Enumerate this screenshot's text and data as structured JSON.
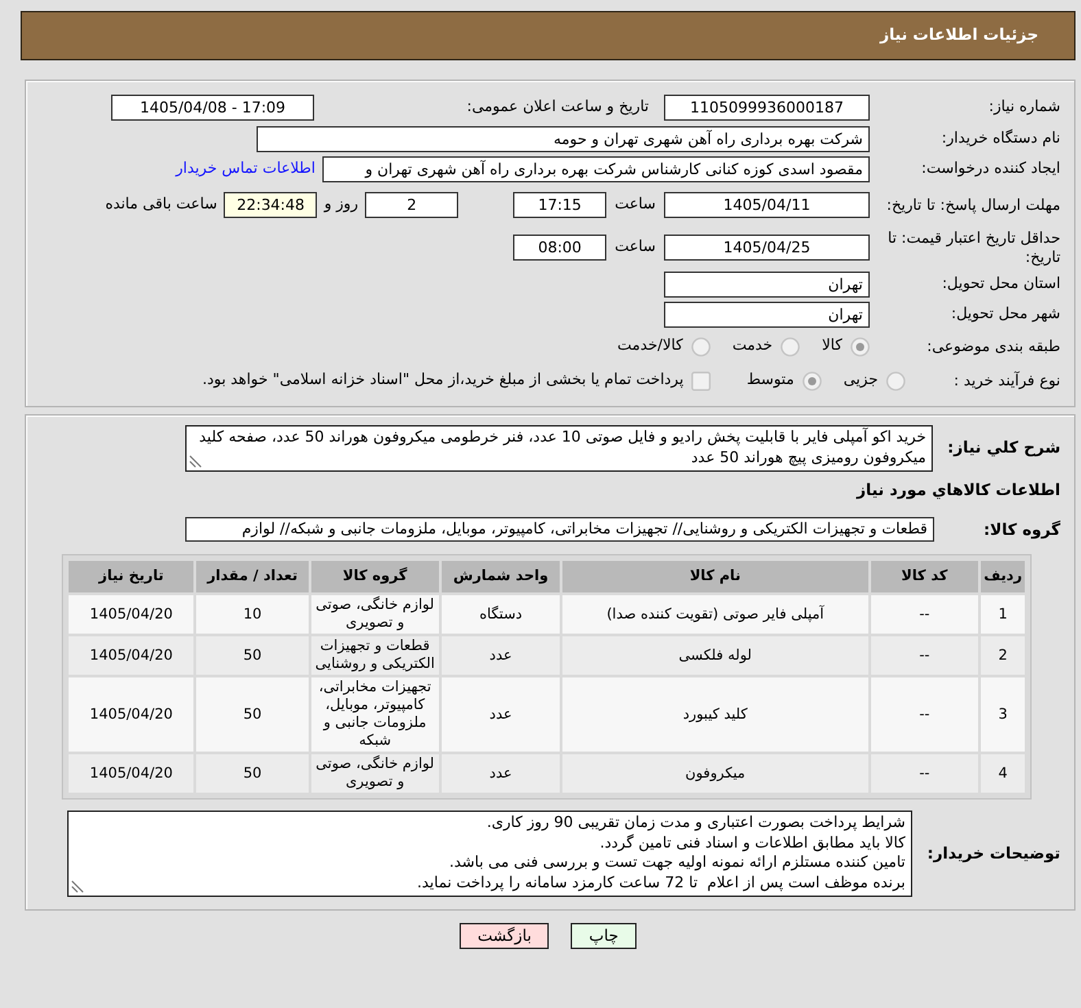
{
  "header": {
    "title": "جزئیات اطلاعات نیاز"
  },
  "details": {
    "need_number": {
      "label": "شماره نیاز:",
      "value": "1105099936000187"
    },
    "announce_date": {
      "label": "تاریخ و ساعت اعلان عمومی:",
      "value": "1405/04/08 - 17:09"
    },
    "buyer_org": {
      "label": "نام دستگاه خریدار:",
      "value": "شرکت بهره برداری راه آهن شهری تهران و حومه"
    },
    "requester": {
      "label": "ایجاد کننده درخواست:",
      "value": "مقصود اسدی کوزه کنانی کارشناس شرکت بهره برداری راه آهن شهری تهران و",
      "contact_link": "اطلاعات تماس خریدار"
    },
    "reply_deadline": {
      "label": "مهلت ارسال پاسخ: تا تاریخ:",
      "date": "1405/04/11",
      "time_label": "ساعت",
      "time": "17:15",
      "days": "2",
      "days_label": "روز و",
      "remaining": "22:34:48",
      "remaining_label": "ساعت باقی مانده"
    },
    "price_validity": {
      "label": "حداقل تاریخ اعتبار قیمت: تا تاریخ:",
      "date": "1405/04/25",
      "time_label": "ساعت",
      "time": "08:00"
    },
    "delivery_province": {
      "label": "استان محل تحویل:",
      "value": "تهران"
    },
    "delivery_city": {
      "label": "شهر محل تحویل:",
      "value": "تهران"
    },
    "category": {
      "label": "طبقه بندی موضوعی:",
      "options": [
        {
          "label": "کالا",
          "selected": true,
          "disabled": true
        },
        {
          "label": "خدمت",
          "selected": false,
          "disabled": true
        },
        {
          "label": "کالا/خدمت",
          "selected": false,
          "disabled": true
        }
      ]
    },
    "purchase_process": {
      "label": "نوع فرآیند خرید :",
      "options": [
        {
          "label": "جزیی",
          "selected": false,
          "disabled": true
        },
        {
          "label": "متوسط",
          "selected": true,
          "disabled": true
        }
      ],
      "treasury_payment": {
        "label": "پرداخت تمام یا بخشی از مبلغ خرید،از محل \"اسناد خزانه اسلامی\" خواهد بود.",
        "checked": false,
        "disabled": true
      }
    }
  },
  "summary": {
    "label": "شرح کلي نیاز:",
    "text": "خرید اکو آمپلی فایر با قابلیت پخش رادیو و فایل صوتی 10 عدد، فنر خرطومی میکروفون هوراند 50 عدد، صفحه کلید میکروفون رومیزی پیچ هوراند 50 عدد"
  },
  "goods": {
    "title": "اطلاعات کالاهاي مورد نیاز",
    "group_label": "گروه کالا:",
    "group": "قطعات و تجهیزات الکتریکی و روشنایی// تجهیزات مخابراتی، کامپیوتر، موبایل، ملزومات جانبی و شبکه// لوازم"
  },
  "table": {
    "columns": [
      "ردیف",
      "کد کالا",
      "نام کالا",
      "واحد شمارش",
      "گروه کالا",
      "تعداد / مقدار",
      "تاریخ نیاز"
    ],
    "rows": [
      [
        "1",
        "--",
        "آمپلی فایر صوتی (تقویت کننده صدا)",
        "دستگاه",
        "لوازم خانگی، صوتی و تصویری",
        "10",
        "1405/04/20"
      ],
      [
        "2",
        "--",
        "لوله فلکسی",
        "عدد",
        "قطعات و تجهیزات الکتریکی و روشنایی",
        "50",
        "1405/04/20"
      ],
      [
        "3",
        "--",
        "کلید کیبورد",
        "عدد",
        "تجهیزات مخابراتی، کامپیوتر، موبایل، ملزومات جانبی و شبکه",
        "50",
        "1405/04/20"
      ],
      [
        "4",
        "--",
        "میکروفون",
        "عدد",
        "لوازم خانگی، صوتی و تصویری",
        "50",
        "1405/04/20"
      ]
    ]
  },
  "notes": {
    "label": "توضیحات خریدار:",
    "text": "شرایط پرداخت بصورت اعتباری و مدت زمان تقریبی 90 روز کاری.\nکالا باید مطابق اطلاعات و اسناد فنی تامین گردد.\nتامین کننده مستلزم ارائه نمونه اولیه جهت تست و بررسی فنی می باشد.\nبرنده موظف است پس از اعلام  تا 72 ساعت کارمزد سامانه را پرداخت نماید."
  },
  "buttons": [
    {
      "label": "چاپ",
      "kind": "print"
    },
    {
      "label": "بازگشت",
      "kind": "back"
    }
  ]
}
